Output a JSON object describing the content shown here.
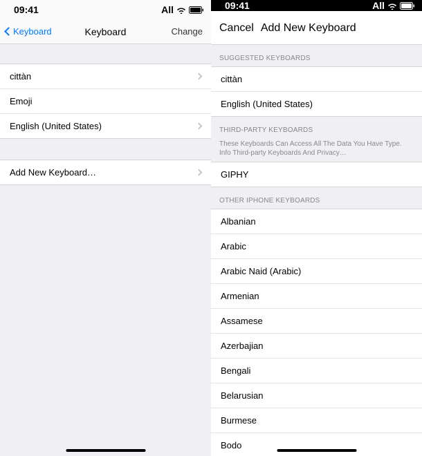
{
  "status": {
    "time": "09:41",
    "carrier": "All"
  },
  "left": {
    "back_label": "Keyboard",
    "title": "Keyboard",
    "edit": "Change",
    "keyboards": [
      {
        "label": "cittàn",
        "chevron": true
      },
      {
        "label": "Emoji",
        "chevron": false
      },
      {
        "label": "English (United States)",
        "chevron": true
      }
    ],
    "add_label": "Add New Keyboard…"
  },
  "right": {
    "cancel": "Cancel",
    "title": "Add New Keyboard",
    "section_suggested": "SUGGESTED KEYBOARDS",
    "suggested": [
      "cittàn",
      "English (United States)"
    ],
    "section_third": "THIRD-PARTY KEYBOARDS",
    "third_sub": "These Keyboards Can Access All The Data You Have Type. Info Third-party Keyboards And Privacy…",
    "third_party": [
      "GIPHY"
    ],
    "section_other": "OTHER IPHONE KEYBOARDS",
    "other": [
      "Albanian",
      "Arabic",
      "Arabic Naid (Arabic)",
      "Armenian",
      "Assamese",
      "Azerbajian",
      "Bengali",
      "Belarusian",
      "Burmese",
      "Bodo"
    ]
  }
}
